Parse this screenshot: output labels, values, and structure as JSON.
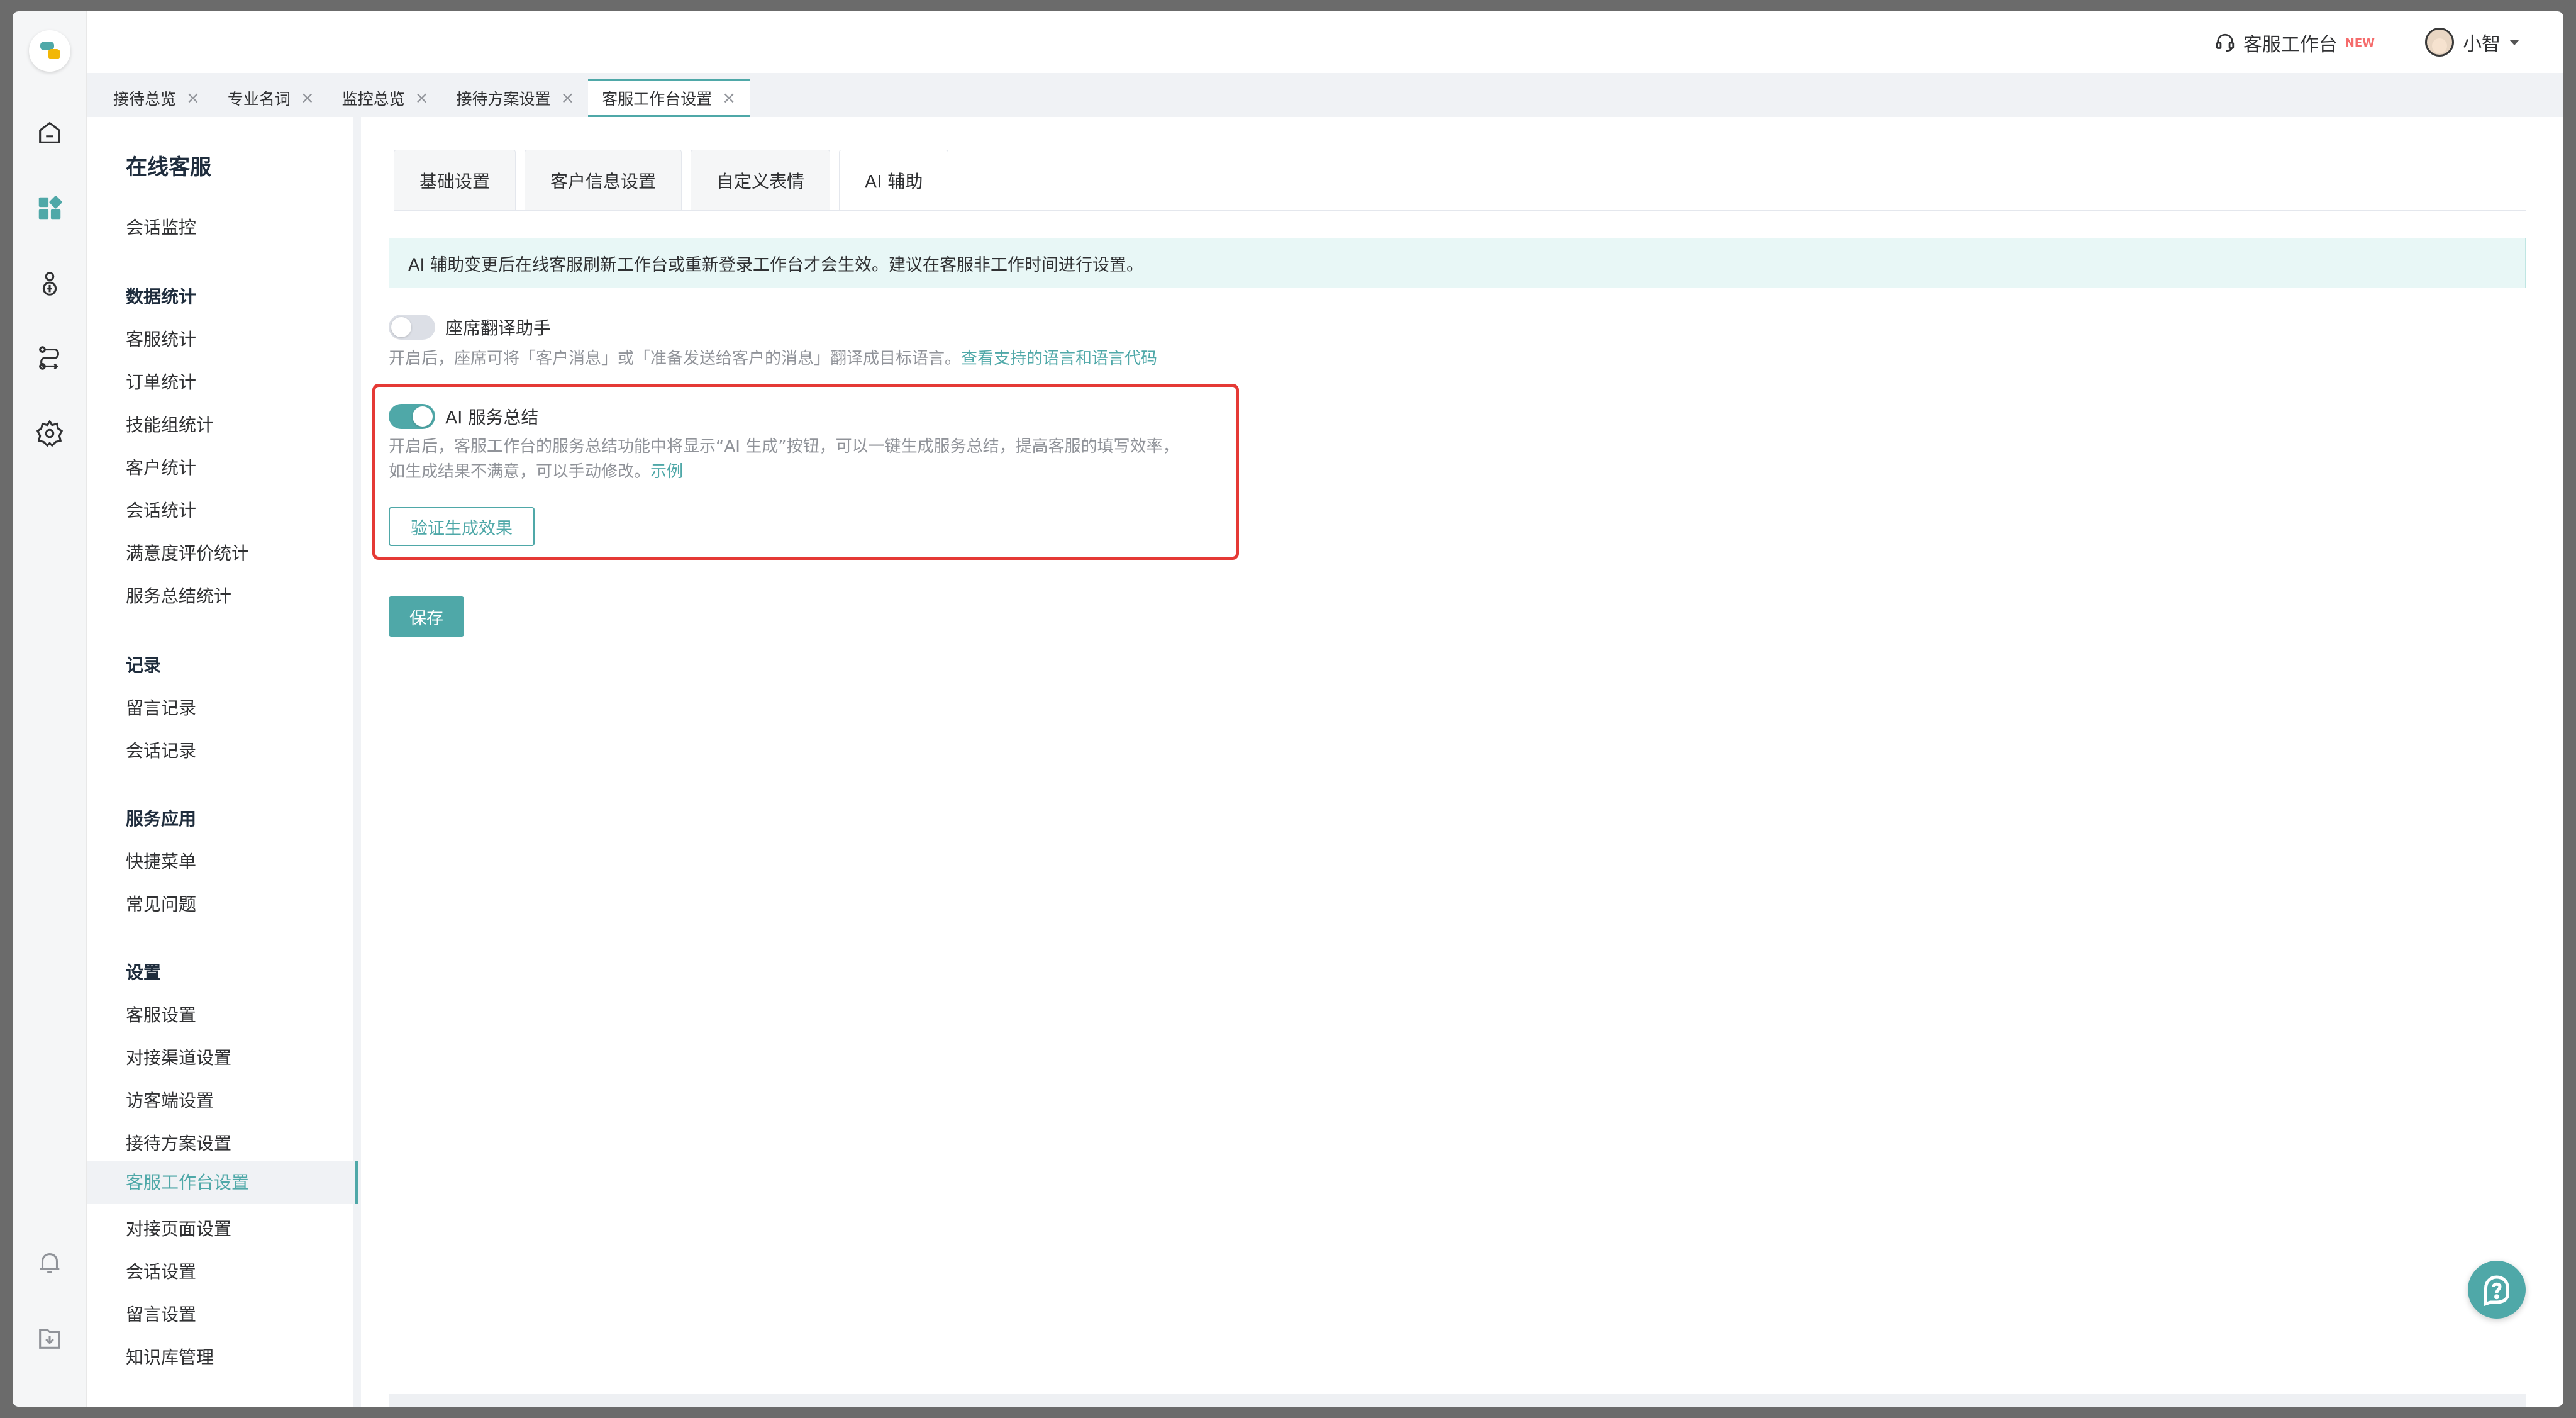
{
  "header": {
    "workbench_label": "客服工作台",
    "workbench_badge": "NEW",
    "user_name": "小智"
  },
  "page_tabs": [
    {
      "label": "接待总览"
    },
    {
      "label": "专业名词"
    },
    {
      "label": "监控总览"
    },
    {
      "label": "接待方案设置"
    },
    {
      "label": "客服工作台设置"
    }
  ],
  "subnav": {
    "title": "在线客服",
    "items": {
      "monitor": "会话监控",
      "g_stats": "数据统计",
      "agent_stats": "客服统计",
      "order_stats": "订单统计",
      "skill_stats": "技能组统计",
      "customer_stats": "客户统计",
      "session_stats": "会话统计",
      "satisfaction_stats": "满意度评价统计",
      "summary_stats": "服务总结统计",
      "g_records": "记录",
      "message_records": "留言记录",
      "session_records": "会话记录",
      "g_apps": "服务应用",
      "quick_menu": "快捷菜单",
      "faq": "常见问题",
      "g_settings": "设置",
      "agent_settings": "客服设置",
      "channel_settings": "对接渠道设置",
      "visitor_settings": "访客端设置",
      "plan_settings": "接待方案设置",
      "workbench_settings": "客服工作台设置",
      "page_settings": "对接页面设置",
      "session_settings": "会话设置",
      "message_settings": "留言设置",
      "kb_manage": "知识库管理"
    }
  },
  "content_tabs": [
    "基础设置",
    "客户信息设置",
    "自定义表情",
    "AI 辅助"
  ],
  "notice": "AI 辅助变更后在线客服刷新工作台或重新登录工作台才会生效。建议在客服非工作时间进行设置。",
  "translate": {
    "label": "座席翻译助手",
    "enabled": false,
    "desc": "开启后，座席可将「客户消息」或「准备发送给客户的消息」翻译成目标语言。",
    "link": "查看支持的语言和语言代码"
  },
  "summary": {
    "label": "AI 服务总结",
    "enabled": true,
    "desc_line1": "开启后，客服工作台的服务总结功能中将显示“AI 生成”按钮，可以一键生成服务总结，提高客服的填写效率，",
    "desc_line2": "如生成结果不满意，可以手动修改。",
    "link": "示例",
    "verify_button": "验证生成效果"
  },
  "save_button": "保存",
  "colors": {
    "accent": "#4fa8a8",
    "highlight_border": "#e53935"
  }
}
